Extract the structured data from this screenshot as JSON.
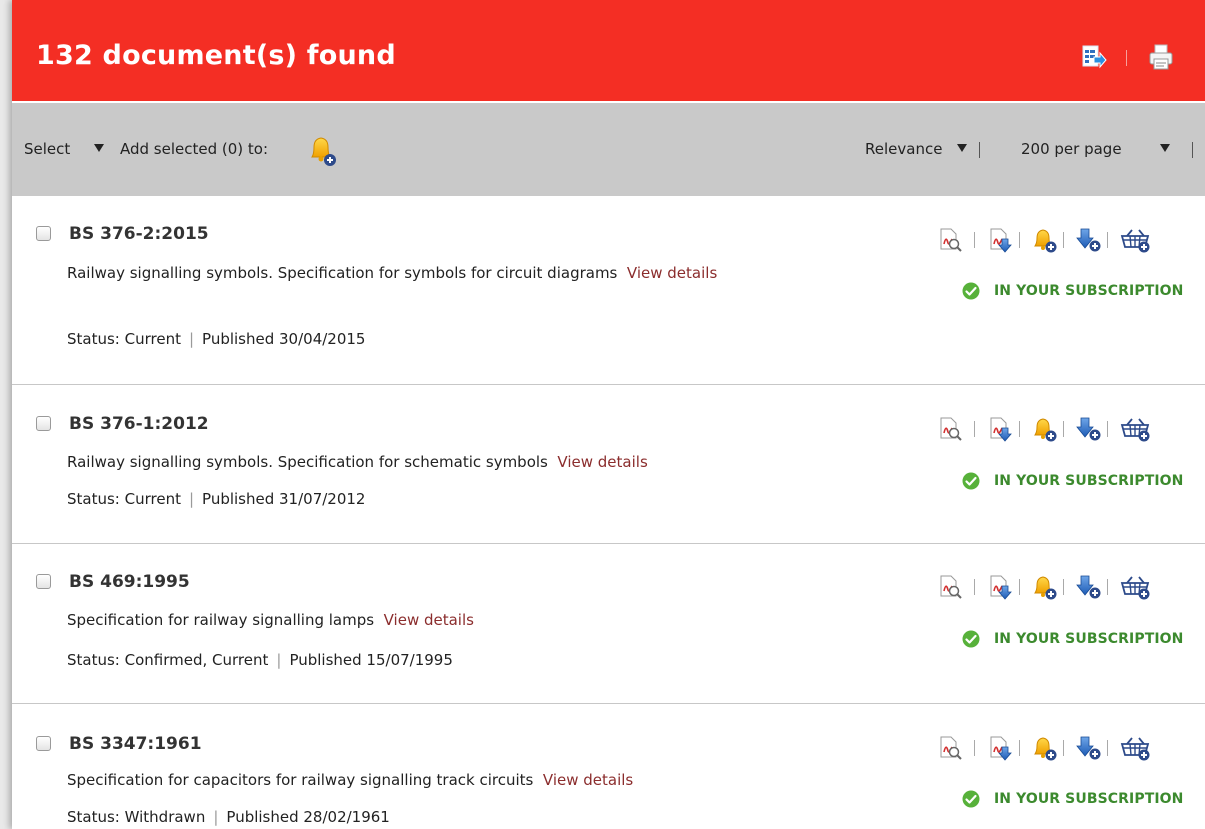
{
  "header": {
    "title": "132 document(s) found",
    "export_icon": "export-icon",
    "print_icon": "print-icon",
    "color": "#f42e24"
  },
  "toolbar": {
    "select_label": "Select",
    "add_selected_label": "Add selected (0) to:",
    "alert_icon": "bell-add-icon",
    "sort_label": "Relevance",
    "per_page_label": "200 per page"
  },
  "results": [
    {
      "code": "BS 376-2:2015",
      "title": "Railway signalling symbols. Specification for symbols for circuit diagrams",
      "view_details": "View details",
      "status": "Status: Current",
      "published": "Published 30/04/2015",
      "subscription": "IN YOUR SUBSCRIPTION"
    },
    {
      "code": "BS 376-1:2012",
      "title": "Railway signalling symbols. Specification for schematic symbols",
      "view_details": "View details",
      "status": "Status: Current",
      "published": "Published 31/07/2012",
      "subscription": "IN YOUR SUBSCRIPTION"
    },
    {
      "code": "BS 469:1995",
      "title": "Specification for railway signalling lamps",
      "view_details": "View details",
      "status": "Status: Confirmed, Current",
      "published": "Published 15/07/1995",
      "subscription": "IN YOUR SUBSCRIPTION"
    },
    {
      "code": "BS 3347:1961",
      "title": "Specification for capacitors for railway signalling track circuits",
      "view_details": "View details",
      "status": "Status: Withdrawn",
      "published": "Published 28/02/1961",
      "subscription": "IN YOUR SUBSCRIPTION"
    }
  ],
  "row_action_icons": [
    "pdf-preview-icon",
    "pdf-download-icon",
    "bell-add-icon",
    "download-add-icon",
    "basket-add-icon"
  ],
  "colors": {
    "header_bg": "#f42e24",
    "toolbar_bg": "#c9c9c9",
    "link": "#8b2d2d",
    "subscription_green": "#3c8a2e"
  }
}
